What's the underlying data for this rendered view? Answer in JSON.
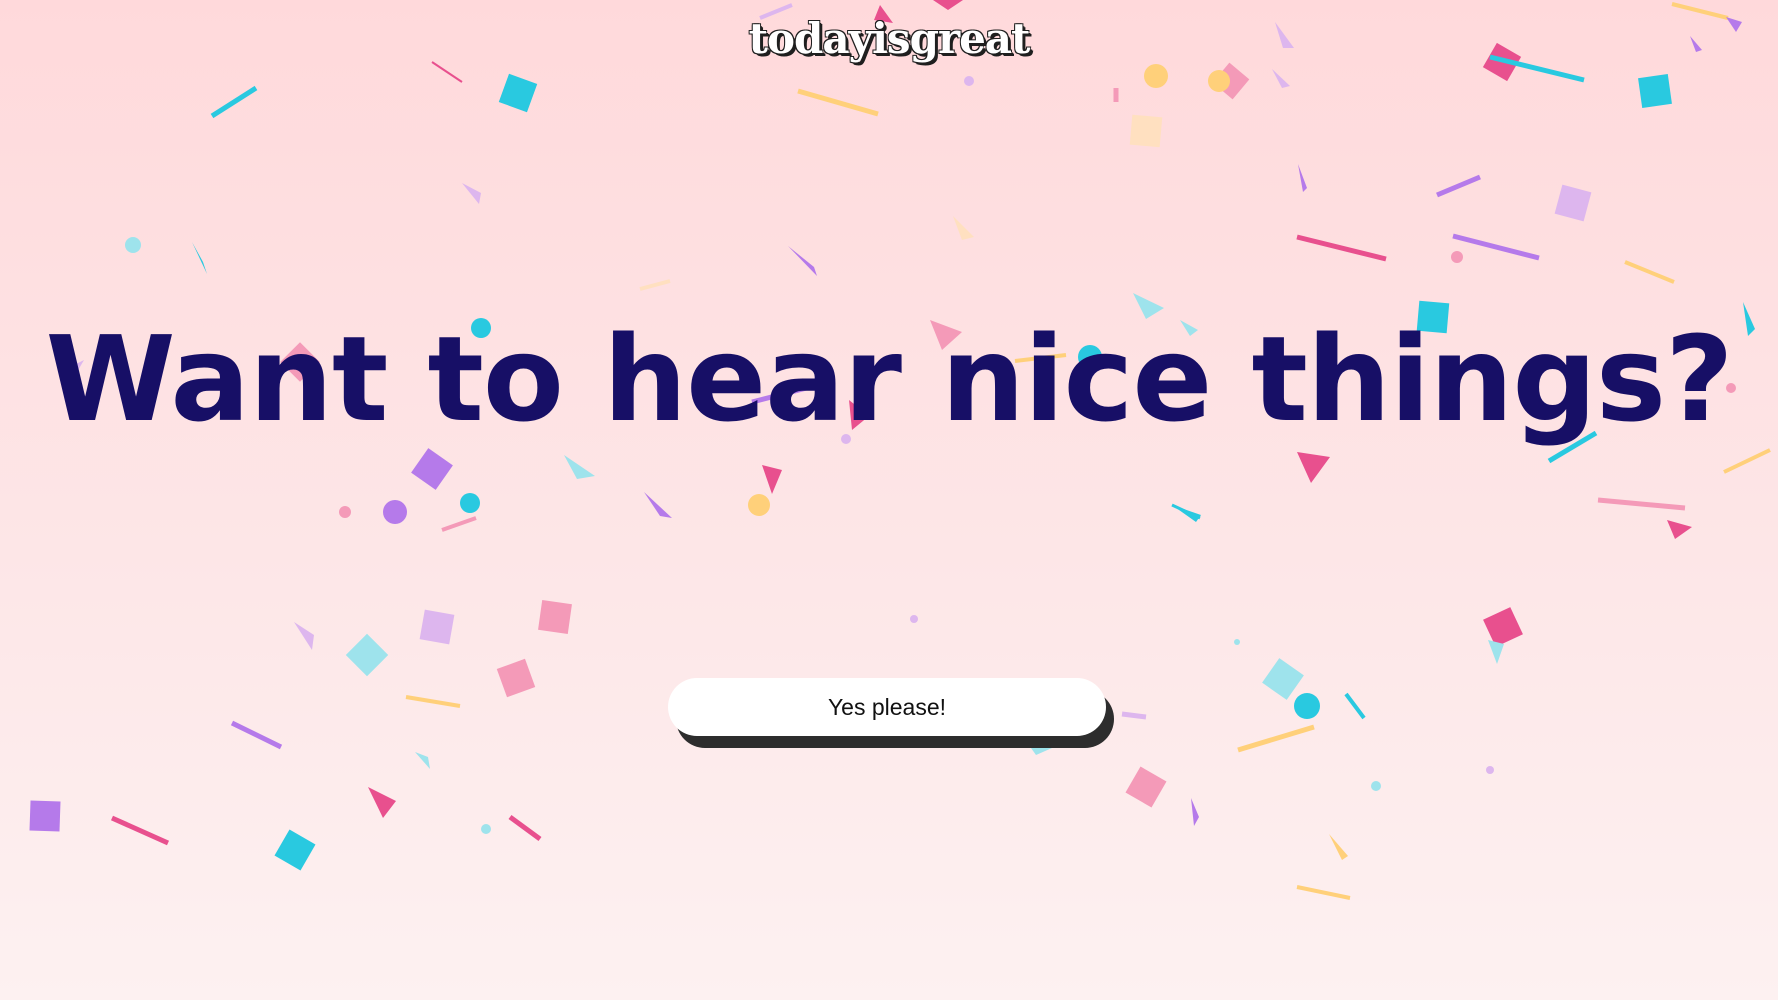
{
  "logo": {
    "text": "todayisgreat"
  },
  "headline": {
    "text": "Want to hear nice things?"
  },
  "cta": {
    "label": "Yes please!"
  },
  "colors": {
    "background_top": "#ffd9db",
    "background_bottom": "#fdf1f1",
    "headline": "#170f66",
    "button_bg": "#ffffff",
    "button_shadow": "#2d2d2d",
    "confetti": [
      "#29c9e0",
      "#e8508e",
      "#b57aea",
      "#ffd07a",
      "#f49ab8",
      "#9ee3ec",
      "#ddb6ee"
    ]
  }
}
